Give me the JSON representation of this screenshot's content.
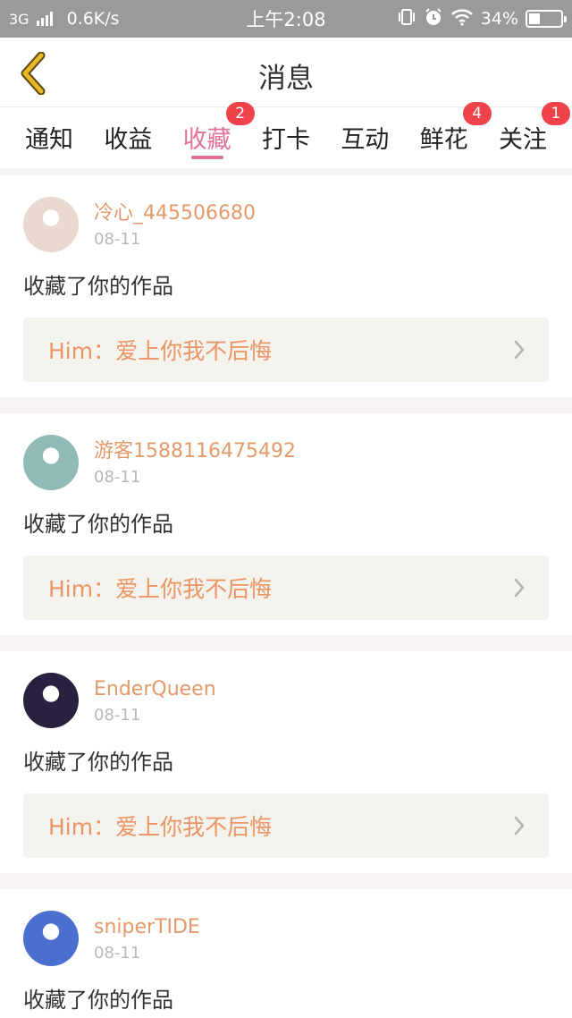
{
  "status_bar": {
    "network": "3G",
    "speed": "0.6K/s",
    "time": "上午2:08",
    "battery": "34%",
    "battery_level": 0.34
  },
  "header": {
    "title": "消息"
  },
  "tabs": [
    {
      "label": "通知",
      "badge": ""
    },
    {
      "label": "收益",
      "badge": ""
    },
    {
      "label": "收藏",
      "badge": "2",
      "active": true
    },
    {
      "label": "打卡",
      "badge": ""
    },
    {
      "label": "互动",
      "badge": ""
    },
    {
      "label": "鲜花",
      "badge": "4"
    },
    {
      "label": "关注",
      "badge": "1"
    }
  ],
  "feed": [
    {
      "user": "冷心_445506680",
      "date": "08-11",
      "action": "收藏了你的作品",
      "work": "Him：爱上你我不后悔",
      "avatar_color": "#e9d9cf"
    },
    {
      "user": "游客1588116475492",
      "date": "08-11",
      "action": "收藏了你的作品",
      "work": "Him：爱上你我不后悔",
      "avatar_color": "#8fbab5"
    },
    {
      "user": "EnderQueen",
      "date": "08-11",
      "action": "收藏了你的作品",
      "work": "Him：爱上你我不后悔",
      "avatar_color": "#2a2140"
    },
    {
      "user": "sniperTIDE",
      "date": "08-11",
      "action": "收藏了你的作品",
      "work": "",
      "avatar_color": "#4a6fcf"
    }
  ],
  "colors": {
    "accent": "#e0719a",
    "username": "#e39a6b",
    "work_title": "#eb9565",
    "badge": "#f0424a",
    "back_arrow": "#e9b829"
  }
}
